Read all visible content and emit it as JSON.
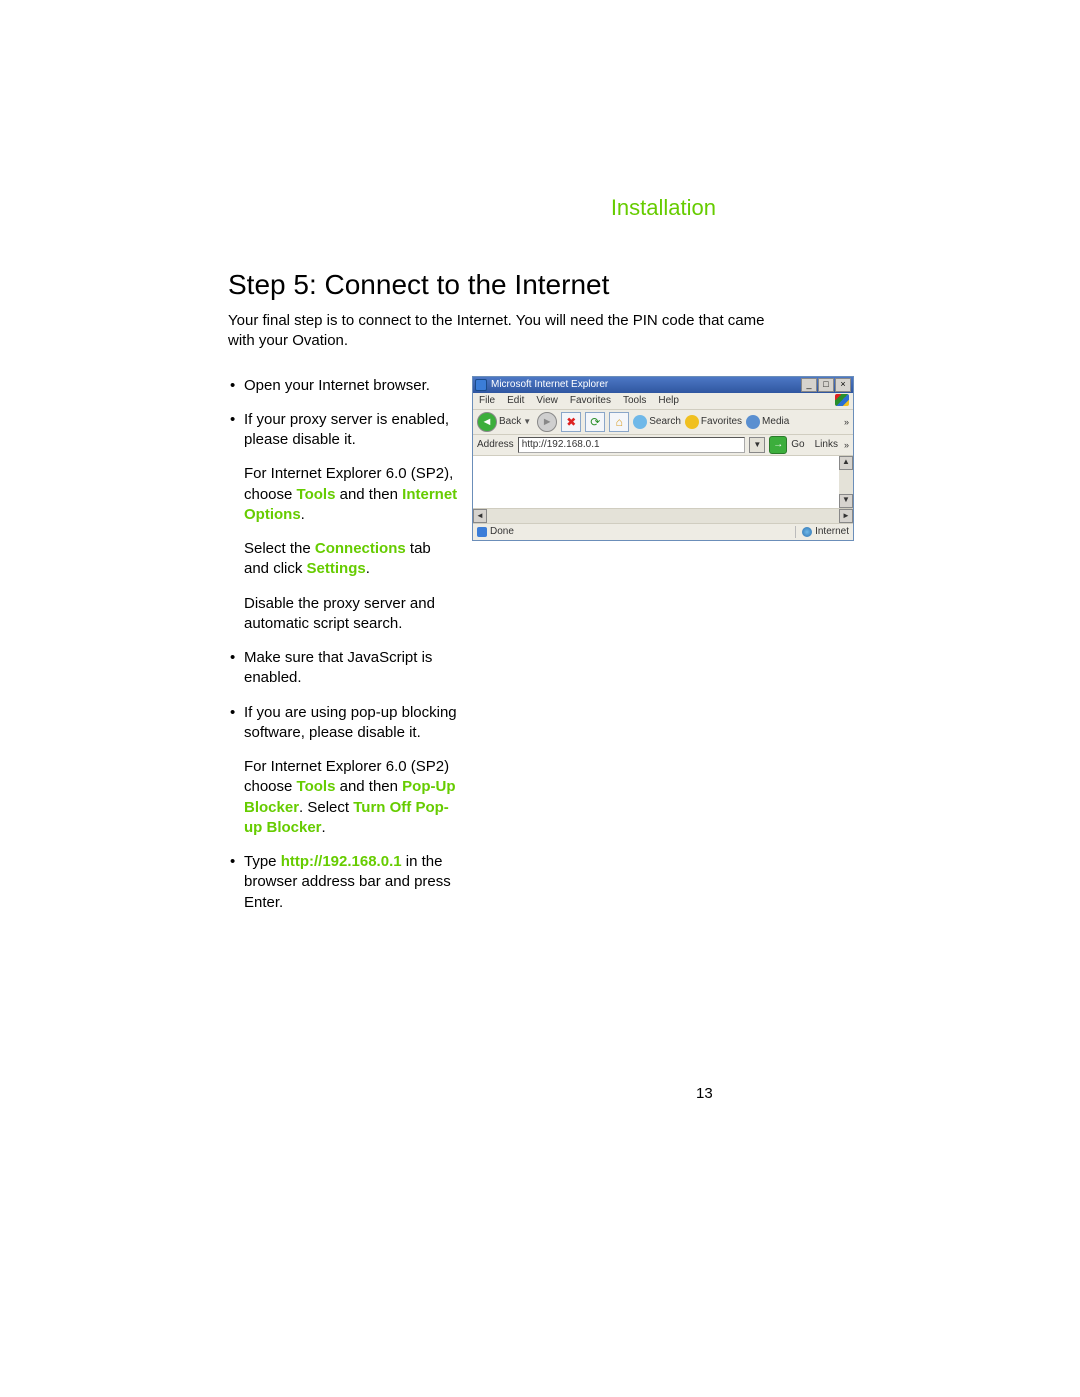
{
  "section_label": "Installation",
  "step_title": "Step 5: Connect to the Internet",
  "intro": "Your final step is to connect to the Internet. You will need the PIN code that came with your Ovation.",
  "bullets": {
    "b1": "Open your Internet browser.",
    "b2": "If your proxy server is enabled, please disable it.",
    "b2_sub1_a": "For Internet Explorer 6.0 (SP2), choose ",
    "b2_sub1_tools": "Tools",
    "b2_sub1_b": " and then ",
    "b2_sub1_io": "Internet Options",
    "b2_sub1_c": ".",
    "b2_sub2_a": "Select the ",
    "b2_sub2_conn": "Connections",
    "b2_sub2_b": " tab and click ",
    "b2_sub2_set": "Settings",
    "b2_sub2_c": ".",
    "b2_sub3": "Disable the proxy server and automatic script search.",
    "b3": "Make sure that JavaScript is enabled.",
    "b4": "If you are using pop-up blocking software, please disable it.",
    "b4_sub1_a": "For Internet Explorer 6.0 (SP2) choose ",
    "b4_sub1_tools": "Tools",
    "b4_sub1_b": " and then ",
    "b4_sub1_pub": "Pop-Up Blocker",
    "b4_sub1_c": ". Select ",
    "b4_sub1_turn": "Turn Off Pop-up Blocker",
    "b4_sub1_d": ".",
    "b5_a": "Type ",
    "b5_url": "http://192.168.0.1",
    "b5_b": " in the browser address bar and press Enter."
  },
  "ie": {
    "title": "Microsoft Internet Explorer",
    "menu": {
      "file": "File",
      "edit": "Edit",
      "view": "View",
      "favorites": "Favorites",
      "tools": "Tools",
      "help": "Help"
    },
    "toolbar": {
      "back": "Back",
      "search": "Search",
      "favorites": "Favorites",
      "media": "Media"
    },
    "address_label": "Address",
    "address_value": "http://192.168.0.1",
    "go": "Go",
    "links": "Links",
    "status_done": "Done",
    "status_zone": "Internet"
  },
  "page_number": "13"
}
